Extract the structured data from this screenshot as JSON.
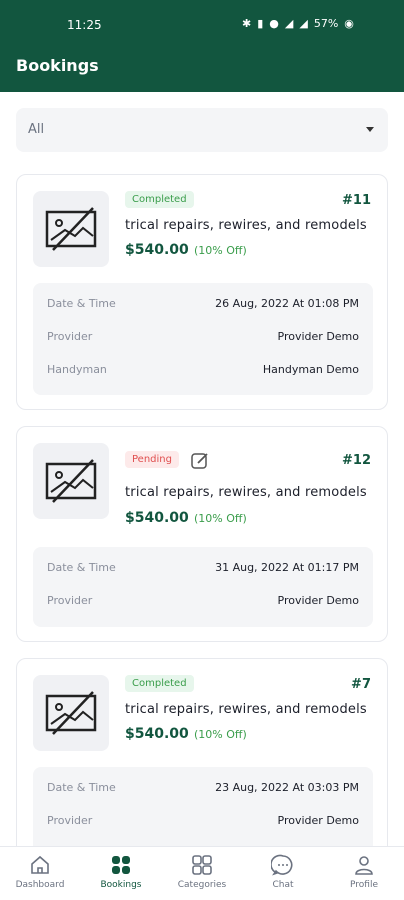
{
  "status_bar": {
    "time": "11:25",
    "battery": "57%"
  },
  "header": {
    "title": "Bookings"
  },
  "filter": {
    "selected": "All"
  },
  "bookings": [
    {
      "status": "Completed",
      "id": "#11",
      "service": "trical repairs, rewires, and remodels",
      "price": "$540.00",
      "discount": "(10% Off)",
      "details": [
        {
          "label": "Date & Time",
          "value": "26 Aug, 2022 At 01:08 PM"
        },
        {
          "label": "Provider",
          "value": "Provider Demo"
        },
        {
          "label": "Handyman",
          "value": "Handyman Demo"
        }
      ]
    },
    {
      "status": "Pending",
      "id": "#12",
      "service": "trical repairs, rewires, and remodels",
      "price": "$540.00",
      "discount": "(10% Off)",
      "details": [
        {
          "label": "Date & Time",
          "value": "31 Aug, 2022 At 01:17 PM"
        },
        {
          "label": "Provider",
          "value": "Provider Demo"
        }
      ]
    },
    {
      "status": "Completed",
      "id": "#7",
      "service": "trical repairs, rewires, and remodels",
      "price": "$540.00",
      "discount": "(10% Off)",
      "details": [
        {
          "label": "Date & Time",
          "value": "23 Aug, 2022 At 03:03 PM"
        },
        {
          "label": "Provider",
          "value": "Provider Demo"
        }
      ]
    }
  ],
  "bottom_nav": [
    {
      "label": "Dashboard",
      "icon": "home-icon"
    },
    {
      "label": "Bookings",
      "icon": "grid-icon"
    },
    {
      "label": "Categories",
      "icon": "categories-icon"
    },
    {
      "label": "Chat",
      "icon": "chat-icon"
    },
    {
      "label": "Profile",
      "icon": "profile-icon"
    }
  ],
  "colors": {
    "primary": "#12563f",
    "completed": "#3a9d4b",
    "pending": "#e05050"
  }
}
